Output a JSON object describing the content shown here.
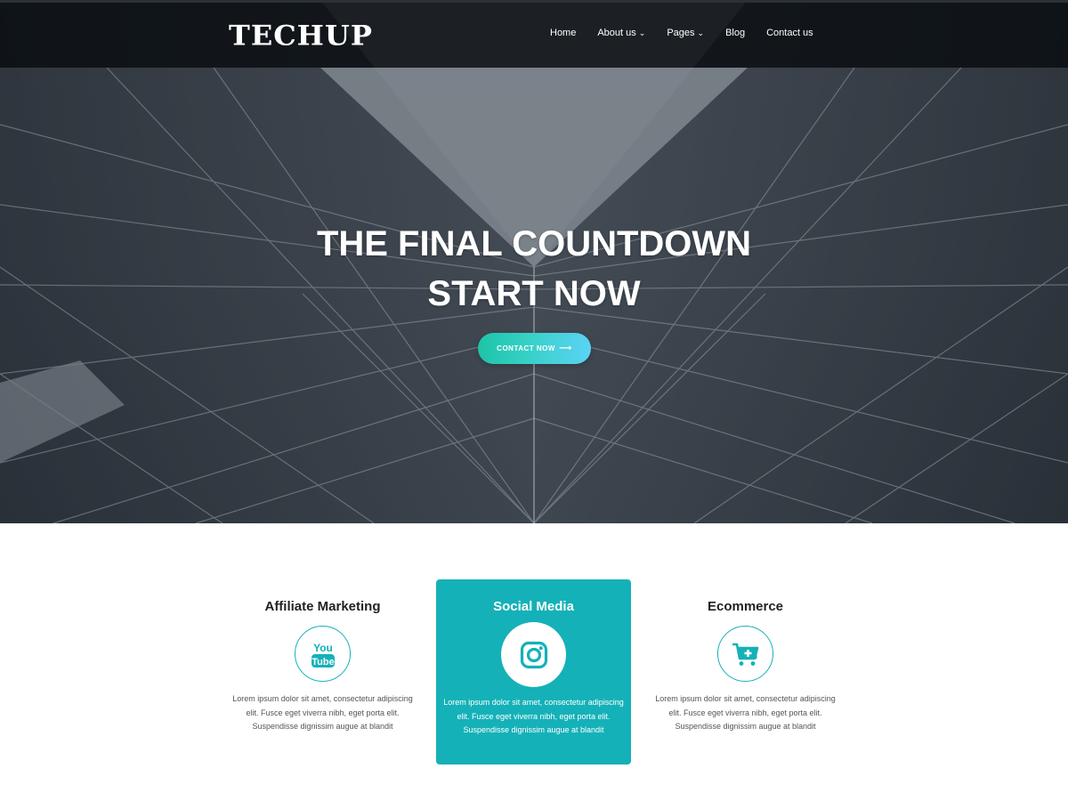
{
  "brand": {
    "logo": "TECHUP"
  },
  "nav": {
    "items": [
      {
        "label": "Home",
        "has_dropdown": false
      },
      {
        "label": "About us",
        "has_dropdown": true
      },
      {
        "label": "Pages",
        "has_dropdown": true
      },
      {
        "label": "Blog",
        "has_dropdown": false
      },
      {
        "label": "Contact us",
        "has_dropdown": false
      }
    ],
    "chevron": "⌄"
  },
  "hero": {
    "title_line1": "THE FINAL COUNTDOWN",
    "title_line2": "START NOW",
    "cta_label": "CONTACT NOW",
    "cta_arrow": "⟶"
  },
  "services": [
    {
      "title": "Affiliate Marketing",
      "icon": "youtube-icon",
      "text": "Lorem ipsum dolor sit amet, consectetur adipiscing elit. Fusce eget viverra nibh, eget porta elit. Suspendisse dignissim augue at blandit",
      "highlighted": false
    },
    {
      "title": "Social Media",
      "icon": "instagram-icon",
      "text": "Lorem ipsum dolor sit amet, consectetur adipiscing elit. Fusce eget viverra nibh, eget porta elit. Suspendisse dignissim augue at blandit",
      "highlighted": true
    },
    {
      "title": "Ecommerce",
      "icon": "shopping-cart-icon",
      "text": "Lorem ipsum dolor sit amet, consectetur adipiscing elit. Fusce eget viverra nibh, eget porta elit. Suspendisse dignissim augue at blandit",
      "highlighted": false
    }
  ],
  "colors": {
    "accent": "#15b1b8",
    "cta_gradient_start": "#1cc4a7",
    "cta_gradient_end": "#5ad3f5",
    "topbar": "#0c1014"
  },
  "youtube_icon_text": {
    "top": "You",
    "bottom": "Tube"
  }
}
